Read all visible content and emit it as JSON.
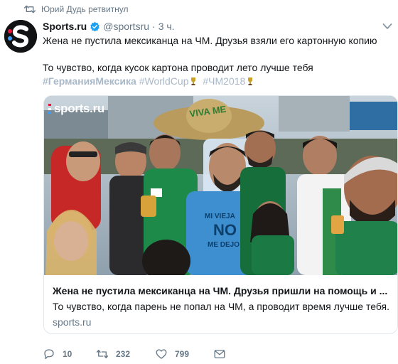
{
  "retweet_context": {
    "text": "Юрий Дудь ретвитнул",
    "icon": "retweet-icon"
  },
  "tweet": {
    "author_name": "Sports.ru",
    "verified": true,
    "handle": "@sportsru",
    "separator": "·",
    "time": "3 ч.",
    "text_line1": "Жена не пустила мексиканца на ЧМ. Друзья взяли его картонную копию",
    "text_line2": "То чувство, когда кусок картона проводит лето лучше тебя",
    "hashtags": [
      "#ГерманияМексика",
      "#WorldCup",
      "#ЧМ2018"
    ]
  },
  "card": {
    "watermark": "sports.ru",
    "sign_text": "VIVA ME",
    "shirt_text": [
      "MI VIEJA",
      "NO",
      "ME DEJO"
    ],
    "title": "Жена не пустила мексиканца на ЧМ. Друзья пришли на помощь и ...",
    "description": "То чувство, когда парень не попал на ЧМ, а проводит время лучше тебя.",
    "domain": "sports.ru"
  },
  "actions": {
    "reply_count": "10",
    "retweet_count": "232",
    "like_count": "799"
  },
  "colors": {
    "retweet_green": "#17bf63",
    "hashtag": "#a8b8c8",
    "verified_blue": "#1da1f2",
    "brand_red": "#e8163c",
    "brand_blue": "#3aa0ff"
  }
}
